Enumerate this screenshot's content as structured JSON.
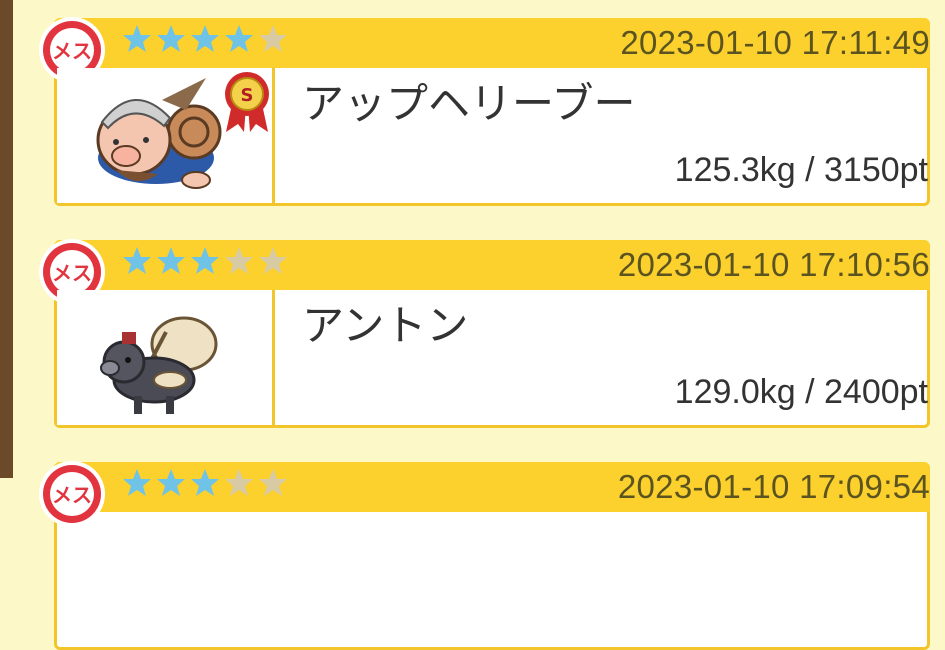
{
  "entries": [
    {
      "gender_label": "メス",
      "rating": 4,
      "max_rating": 5,
      "timestamp": "2023-01-10 17:11:49",
      "name": "アップヘリーブー",
      "stats": "125.3kg / 3150pt",
      "rank_badge": "S",
      "portrait_icon": "viking-pig-icon"
    },
    {
      "gender_label": "メス",
      "rating": 3,
      "max_rating": 5,
      "timestamp": "2023-01-10 17:10:56",
      "name": "アントン",
      "stats": "129.0kg / 2400pt",
      "portrait_icon": "sack-pig-icon"
    },
    {
      "gender_label": "メス",
      "rating": 3,
      "max_rating": 5,
      "timestamp": "2023-01-10 17:09:54"
    }
  ],
  "colors": {
    "background": "#fdf8c8",
    "header": "#fcd12e",
    "star_filled": "#6fc3e6",
    "star_empty": "#d8cba4",
    "gender_red": "#e2343f",
    "rail": "#6b4a2a"
  }
}
